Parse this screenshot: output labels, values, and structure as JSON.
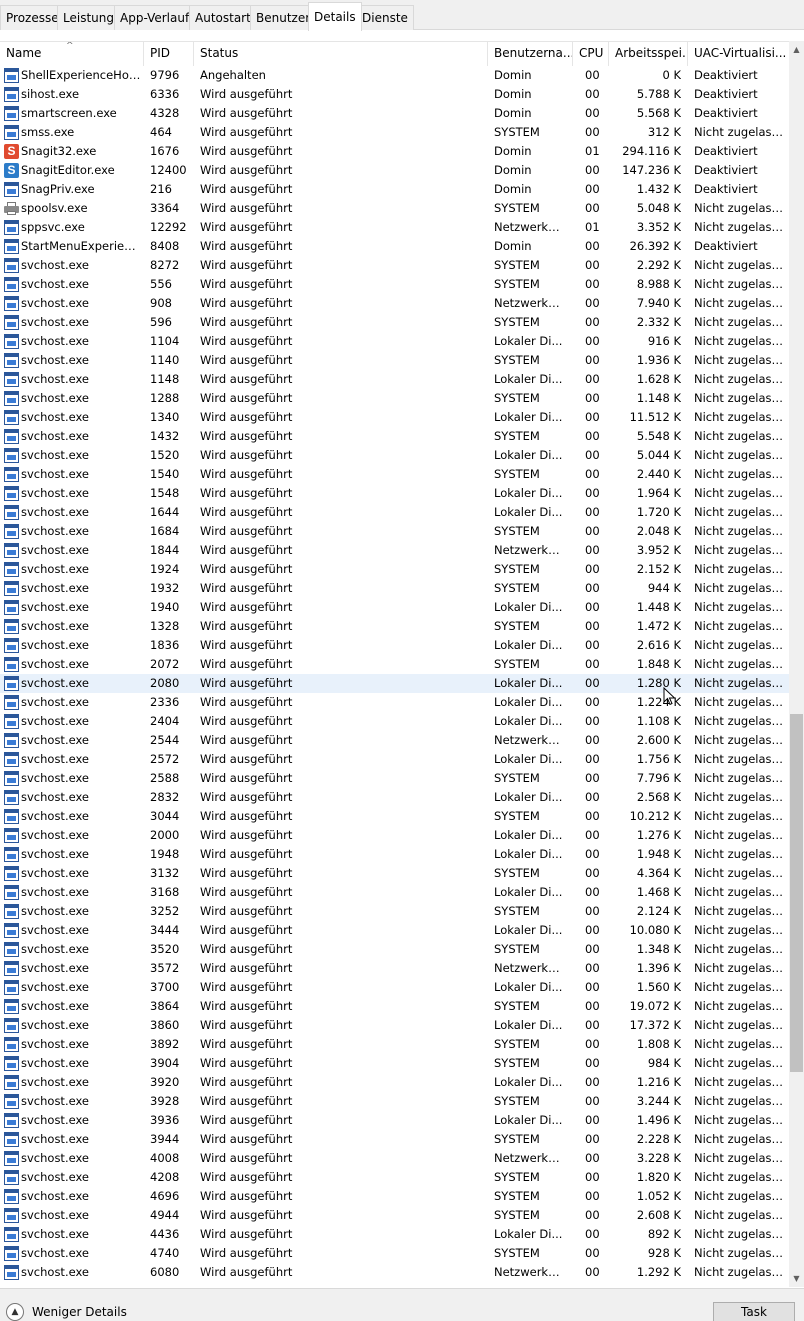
{
  "tabs": [
    {
      "label": "Prozesse",
      "active": false
    },
    {
      "label": "Leistung",
      "active": false
    },
    {
      "label": "App-Verlauf",
      "active": false
    },
    {
      "label": "Autostart",
      "active": false
    },
    {
      "label": "Benutzer",
      "active": false
    },
    {
      "label": "Details",
      "active": true
    },
    {
      "label": "Dienste",
      "active": false
    }
  ],
  "columns": {
    "name": "Name",
    "pid": "PID",
    "status": "Status",
    "user": "Benutzerna...",
    "cpu": "CPU",
    "mem": "Arbeitsspei...",
    "uac": "UAC-Virtualisi..."
  },
  "sort_indicator": "^",
  "rows": [
    {
      "icon": "win",
      "name": "ShellExperienceHost....",
      "pid": "9796",
      "status": "Angehalten",
      "user": "Domin",
      "cpu": "00",
      "mem": "0 K",
      "uac": "Deaktiviert"
    },
    {
      "icon": "win",
      "name": "sihost.exe",
      "pid": "6336",
      "status": "Wird ausgeführt",
      "user": "Domin",
      "cpu": "00",
      "mem": "5.788 K",
      "uac": "Deaktiviert"
    },
    {
      "icon": "win",
      "name": "smartscreen.exe",
      "pid": "4328",
      "status": "Wird ausgeführt",
      "user": "Domin",
      "cpu": "00",
      "mem": "5.568 K",
      "uac": "Deaktiviert"
    },
    {
      "icon": "win",
      "name": "smss.exe",
      "pid": "464",
      "status": "Wird ausgeführt",
      "user": "SYSTEM",
      "cpu": "00",
      "mem": "312 K",
      "uac": "Nicht zugelass..."
    },
    {
      "icon": "snagit-red",
      "name": "Snagit32.exe",
      "pid": "1676",
      "status": "Wird ausgeführt",
      "user": "Domin",
      "cpu": "01",
      "mem": "294.116 K",
      "uac": "Deaktiviert"
    },
    {
      "icon": "snagit-blue",
      "name": "SnagitEditor.exe",
      "pid": "12400",
      "status": "Wird ausgeführt",
      "user": "Domin",
      "cpu": "00",
      "mem": "147.236 K",
      "uac": "Deaktiviert"
    },
    {
      "icon": "win",
      "name": "SnagPriv.exe",
      "pid": "216",
      "status": "Wird ausgeführt",
      "user": "Domin",
      "cpu": "00",
      "mem": "1.432 K",
      "uac": "Deaktiviert"
    },
    {
      "icon": "printer",
      "name": "spoolsv.exe",
      "pid": "3364",
      "status": "Wird ausgeführt",
      "user": "SYSTEM",
      "cpu": "00",
      "mem": "5.048 K",
      "uac": "Nicht zugelass..."
    },
    {
      "icon": "win",
      "name": "sppsvc.exe",
      "pid": "12292",
      "status": "Wird ausgeführt",
      "user": "Netzwerkd...",
      "cpu": "01",
      "mem": "3.352 K",
      "uac": "Nicht zugelass..."
    },
    {
      "icon": "win",
      "name": "StartMenuExperienc...",
      "pid": "8408",
      "status": "Wird ausgeführt",
      "user": "Domin",
      "cpu": "00",
      "mem": "26.392 K",
      "uac": "Deaktiviert"
    },
    {
      "icon": "win",
      "name": "svchost.exe",
      "pid": "8272",
      "status": "Wird ausgeführt",
      "user": "SYSTEM",
      "cpu": "00",
      "mem": "2.292 K",
      "uac": "Nicht zugelass..."
    },
    {
      "icon": "win",
      "name": "svchost.exe",
      "pid": "556",
      "status": "Wird ausgeführt",
      "user": "SYSTEM",
      "cpu": "00",
      "mem": "8.988 K",
      "uac": "Nicht zugelass..."
    },
    {
      "icon": "win",
      "name": "svchost.exe",
      "pid": "908",
      "status": "Wird ausgeführt",
      "user": "Netzwerkd...",
      "cpu": "00",
      "mem": "7.940 K",
      "uac": "Nicht zugelass..."
    },
    {
      "icon": "win",
      "name": "svchost.exe",
      "pid": "596",
      "status": "Wird ausgeführt",
      "user": "SYSTEM",
      "cpu": "00",
      "mem": "2.332 K",
      "uac": "Nicht zugelass..."
    },
    {
      "icon": "win",
      "name": "svchost.exe",
      "pid": "1104",
      "status": "Wird ausgeführt",
      "user": "Lokaler Di...",
      "cpu": "00",
      "mem": "916 K",
      "uac": "Nicht zugelass..."
    },
    {
      "icon": "win",
      "name": "svchost.exe",
      "pid": "1140",
      "status": "Wird ausgeführt",
      "user": "SYSTEM",
      "cpu": "00",
      "mem": "1.936 K",
      "uac": "Nicht zugelass..."
    },
    {
      "icon": "win",
      "name": "svchost.exe",
      "pid": "1148",
      "status": "Wird ausgeführt",
      "user": "Lokaler Di...",
      "cpu": "00",
      "mem": "1.628 K",
      "uac": "Nicht zugelass..."
    },
    {
      "icon": "win",
      "name": "svchost.exe",
      "pid": "1288",
      "status": "Wird ausgeführt",
      "user": "SYSTEM",
      "cpu": "00",
      "mem": "1.148 K",
      "uac": "Nicht zugelass..."
    },
    {
      "icon": "win",
      "name": "svchost.exe",
      "pid": "1340",
      "status": "Wird ausgeführt",
      "user": "Lokaler Di...",
      "cpu": "00",
      "mem": "11.512 K",
      "uac": "Nicht zugelass..."
    },
    {
      "icon": "win",
      "name": "svchost.exe",
      "pid": "1432",
      "status": "Wird ausgeführt",
      "user": "SYSTEM",
      "cpu": "00",
      "mem": "5.548 K",
      "uac": "Nicht zugelass..."
    },
    {
      "icon": "win",
      "name": "svchost.exe",
      "pid": "1520",
      "status": "Wird ausgeführt",
      "user": "Lokaler Di...",
      "cpu": "00",
      "mem": "5.044 K",
      "uac": "Nicht zugelass..."
    },
    {
      "icon": "win",
      "name": "svchost.exe",
      "pid": "1540",
      "status": "Wird ausgeführt",
      "user": "SYSTEM",
      "cpu": "00",
      "mem": "2.440 K",
      "uac": "Nicht zugelass..."
    },
    {
      "icon": "win",
      "name": "svchost.exe",
      "pid": "1548",
      "status": "Wird ausgeführt",
      "user": "Lokaler Di...",
      "cpu": "00",
      "mem": "1.964 K",
      "uac": "Nicht zugelass..."
    },
    {
      "icon": "win",
      "name": "svchost.exe",
      "pid": "1644",
      "status": "Wird ausgeführt",
      "user": "Lokaler Di...",
      "cpu": "00",
      "mem": "1.720 K",
      "uac": "Nicht zugelass..."
    },
    {
      "icon": "win",
      "name": "svchost.exe",
      "pid": "1684",
      "status": "Wird ausgeführt",
      "user": "SYSTEM",
      "cpu": "00",
      "mem": "2.048 K",
      "uac": "Nicht zugelass..."
    },
    {
      "icon": "win",
      "name": "svchost.exe",
      "pid": "1844",
      "status": "Wird ausgeführt",
      "user": "Netzwerkd...",
      "cpu": "00",
      "mem": "3.952 K",
      "uac": "Nicht zugelass..."
    },
    {
      "icon": "win",
      "name": "svchost.exe",
      "pid": "1924",
      "status": "Wird ausgeführt",
      "user": "SYSTEM",
      "cpu": "00",
      "mem": "2.152 K",
      "uac": "Nicht zugelass..."
    },
    {
      "icon": "win",
      "name": "svchost.exe",
      "pid": "1932",
      "status": "Wird ausgeführt",
      "user": "SYSTEM",
      "cpu": "00",
      "mem": "944 K",
      "uac": "Nicht zugelass..."
    },
    {
      "icon": "win",
      "name": "svchost.exe",
      "pid": "1940",
      "status": "Wird ausgeführt",
      "user": "Lokaler Di...",
      "cpu": "00",
      "mem": "1.448 K",
      "uac": "Nicht zugelass..."
    },
    {
      "icon": "win",
      "name": "svchost.exe",
      "pid": "1328",
      "status": "Wird ausgeführt",
      "user": "SYSTEM",
      "cpu": "00",
      "mem": "1.472 K",
      "uac": "Nicht zugelass..."
    },
    {
      "icon": "win",
      "name": "svchost.exe",
      "pid": "1836",
      "status": "Wird ausgeführt",
      "user": "Lokaler Di...",
      "cpu": "00",
      "mem": "2.616 K",
      "uac": "Nicht zugelass..."
    },
    {
      "icon": "win",
      "name": "svchost.exe",
      "pid": "2072",
      "status": "Wird ausgeführt",
      "user": "SYSTEM",
      "cpu": "00",
      "mem": "1.848 K",
      "uac": "Nicht zugelass..."
    },
    {
      "icon": "win",
      "name": "svchost.exe",
      "pid": "2080",
      "status": "Wird ausgeführt",
      "user": "Lokaler Di...",
      "cpu": "00",
      "mem": "1.280 K",
      "uac": "Nicht zugelass...",
      "selected": true
    },
    {
      "icon": "win",
      "name": "svchost.exe",
      "pid": "2336",
      "status": "Wird ausgeführt",
      "user": "Lokaler Di...",
      "cpu": "00",
      "mem": "1.224 K",
      "uac": "Nicht zugelass..."
    },
    {
      "icon": "win",
      "name": "svchost.exe",
      "pid": "2404",
      "status": "Wird ausgeführt",
      "user": "Lokaler Di...",
      "cpu": "00",
      "mem": "1.108 K",
      "uac": "Nicht zugelass..."
    },
    {
      "icon": "win",
      "name": "svchost.exe",
      "pid": "2544",
      "status": "Wird ausgeführt",
      "user": "Netzwerkd...",
      "cpu": "00",
      "mem": "2.600 K",
      "uac": "Nicht zugelass..."
    },
    {
      "icon": "win",
      "name": "svchost.exe",
      "pid": "2572",
      "status": "Wird ausgeführt",
      "user": "Lokaler Di...",
      "cpu": "00",
      "mem": "1.756 K",
      "uac": "Nicht zugelass..."
    },
    {
      "icon": "win",
      "name": "svchost.exe",
      "pid": "2588",
      "status": "Wird ausgeführt",
      "user": "SYSTEM",
      "cpu": "00",
      "mem": "7.796 K",
      "uac": "Nicht zugelass..."
    },
    {
      "icon": "win",
      "name": "svchost.exe",
      "pid": "2832",
      "status": "Wird ausgeführt",
      "user": "Lokaler Di...",
      "cpu": "00",
      "mem": "2.568 K",
      "uac": "Nicht zugelass..."
    },
    {
      "icon": "win",
      "name": "svchost.exe",
      "pid": "3044",
      "status": "Wird ausgeführt",
      "user": "SYSTEM",
      "cpu": "00",
      "mem": "10.212 K",
      "uac": "Nicht zugelass..."
    },
    {
      "icon": "win",
      "name": "svchost.exe",
      "pid": "2000",
      "status": "Wird ausgeführt",
      "user": "Lokaler Di...",
      "cpu": "00",
      "mem": "1.276 K",
      "uac": "Nicht zugelass..."
    },
    {
      "icon": "win",
      "name": "svchost.exe",
      "pid": "1948",
      "status": "Wird ausgeführt",
      "user": "Lokaler Di...",
      "cpu": "00",
      "mem": "1.948 K",
      "uac": "Nicht zugelass..."
    },
    {
      "icon": "win",
      "name": "svchost.exe",
      "pid": "3132",
      "status": "Wird ausgeführt",
      "user": "SYSTEM",
      "cpu": "00",
      "mem": "4.364 K",
      "uac": "Nicht zugelass..."
    },
    {
      "icon": "win",
      "name": "svchost.exe",
      "pid": "3168",
      "status": "Wird ausgeführt",
      "user": "Lokaler Di...",
      "cpu": "00",
      "mem": "1.468 K",
      "uac": "Nicht zugelass..."
    },
    {
      "icon": "win",
      "name": "svchost.exe",
      "pid": "3252",
      "status": "Wird ausgeführt",
      "user": "SYSTEM",
      "cpu": "00",
      "mem": "2.124 K",
      "uac": "Nicht zugelass..."
    },
    {
      "icon": "win",
      "name": "svchost.exe",
      "pid": "3444",
      "status": "Wird ausgeführt",
      "user": "Lokaler Di...",
      "cpu": "00",
      "mem": "10.080 K",
      "uac": "Nicht zugelass..."
    },
    {
      "icon": "win",
      "name": "svchost.exe",
      "pid": "3520",
      "status": "Wird ausgeführt",
      "user": "SYSTEM",
      "cpu": "00",
      "mem": "1.348 K",
      "uac": "Nicht zugelass..."
    },
    {
      "icon": "win",
      "name": "svchost.exe",
      "pid": "3572",
      "status": "Wird ausgeführt",
      "user": "Netzwerkd...",
      "cpu": "00",
      "mem": "1.396 K",
      "uac": "Nicht zugelass..."
    },
    {
      "icon": "win",
      "name": "svchost.exe",
      "pid": "3700",
      "status": "Wird ausgeführt",
      "user": "Lokaler Di...",
      "cpu": "00",
      "mem": "1.560 K",
      "uac": "Nicht zugelass..."
    },
    {
      "icon": "win",
      "name": "svchost.exe",
      "pid": "3864",
      "status": "Wird ausgeführt",
      "user": "SYSTEM",
      "cpu": "00",
      "mem": "19.072 K",
      "uac": "Nicht zugelass..."
    },
    {
      "icon": "win",
      "name": "svchost.exe",
      "pid": "3860",
      "status": "Wird ausgeführt",
      "user": "Lokaler Di...",
      "cpu": "00",
      "mem": "17.372 K",
      "uac": "Nicht zugelass..."
    },
    {
      "icon": "win",
      "name": "svchost.exe",
      "pid": "3892",
      "status": "Wird ausgeführt",
      "user": "SYSTEM",
      "cpu": "00",
      "mem": "1.808 K",
      "uac": "Nicht zugelass..."
    },
    {
      "icon": "win",
      "name": "svchost.exe",
      "pid": "3904",
      "status": "Wird ausgeführt",
      "user": "SYSTEM",
      "cpu": "00",
      "mem": "984 K",
      "uac": "Nicht zugelass..."
    },
    {
      "icon": "win",
      "name": "svchost.exe",
      "pid": "3920",
      "status": "Wird ausgeführt",
      "user": "Lokaler Di...",
      "cpu": "00",
      "mem": "1.216 K",
      "uac": "Nicht zugelass..."
    },
    {
      "icon": "win",
      "name": "svchost.exe",
      "pid": "3928",
      "status": "Wird ausgeführt",
      "user": "SYSTEM",
      "cpu": "00",
      "mem": "3.244 K",
      "uac": "Nicht zugelass..."
    },
    {
      "icon": "win",
      "name": "svchost.exe",
      "pid": "3936",
      "status": "Wird ausgeführt",
      "user": "Lokaler Di...",
      "cpu": "00",
      "mem": "1.496 K",
      "uac": "Nicht zugelass..."
    },
    {
      "icon": "win",
      "name": "svchost.exe",
      "pid": "3944",
      "status": "Wird ausgeführt",
      "user": "SYSTEM",
      "cpu": "00",
      "mem": "2.228 K",
      "uac": "Nicht zugelass..."
    },
    {
      "icon": "win",
      "name": "svchost.exe",
      "pid": "4008",
      "status": "Wird ausgeführt",
      "user": "Netzwerkd...",
      "cpu": "00",
      "mem": "3.228 K",
      "uac": "Nicht zugelass..."
    },
    {
      "icon": "win",
      "name": "svchost.exe",
      "pid": "4208",
      "status": "Wird ausgeführt",
      "user": "SYSTEM",
      "cpu": "00",
      "mem": "1.820 K",
      "uac": "Nicht zugelass..."
    },
    {
      "icon": "win",
      "name": "svchost.exe",
      "pid": "4696",
      "status": "Wird ausgeführt",
      "user": "SYSTEM",
      "cpu": "00",
      "mem": "1.052 K",
      "uac": "Nicht zugelass..."
    },
    {
      "icon": "win",
      "name": "svchost.exe",
      "pid": "4944",
      "status": "Wird ausgeführt",
      "user": "SYSTEM",
      "cpu": "00",
      "mem": "2.608 K",
      "uac": "Nicht zugelass..."
    },
    {
      "icon": "win",
      "name": "svchost.exe",
      "pid": "4436",
      "status": "Wird ausgeführt",
      "user": "Lokaler Di...",
      "cpu": "00",
      "mem": "892 K",
      "uac": "Nicht zugelass..."
    },
    {
      "icon": "win",
      "name": "svchost.exe",
      "pid": "4740",
      "status": "Wird ausgeführt",
      "user": "SYSTEM",
      "cpu": "00",
      "mem": "928 K",
      "uac": "Nicht zugelass..."
    },
    {
      "icon": "win",
      "name": "svchost.exe",
      "pid": "6080",
      "status": "Wird ausgeführt",
      "user": "Netzwerkd...",
      "cpu": "00",
      "mem": "1.292 K",
      "uac": "Nicht zugelass..."
    }
  ],
  "footer": {
    "fewer_details_label": "Weniger Details",
    "end_task_label": "Task beenden"
  },
  "icons": {
    "fewer_details": "chevron-up-circle-icon",
    "process_default": "window-app-icon",
    "snagit": "snagit-icon",
    "spooler": "printer-icon"
  },
  "colors": {
    "selected_row": "#e8f1fb",
    "snagit_red": "#e04a2f",
    "snagit_blue": "#2c7cc9",
    "window_icon": "#2b579a"
  }
}
